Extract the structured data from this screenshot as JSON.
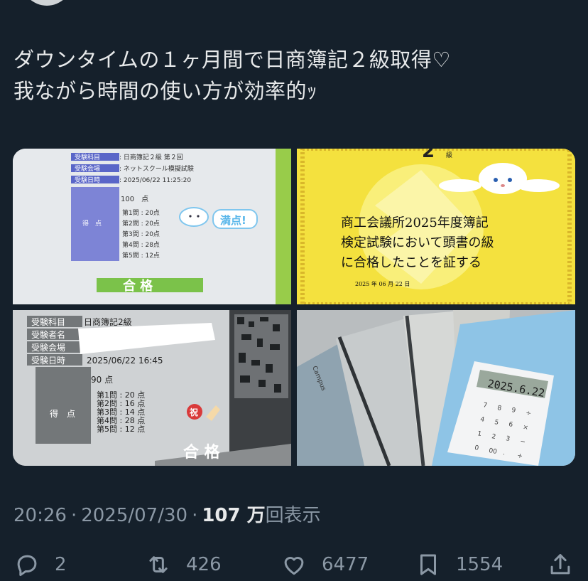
{
  "tweet": {
    "text_line1": "ダウンタイムの１ヶ月間で日商簿記２級取得♡",
    "text_line2": "我ながら時間の使い方が効率的ｯ"
  },
  "photos": {
    "p1": {
      "labels": [
        "受験科目",
        "受験会場",
        "受験日時",
        "得　点"
      ],
      "values": [
        ": 日商簿記２級 第２回",
        ": ネットスクール模擬試験",
        ": 2025/06/22 11:25:20"
      ],
      "total": "100　点",
      "scores": [
        "第1問 : 20点",
        "第2問 : 20点",
        "第3問 : 20点",
        "第4問 : 28点",
        "第5問 : 12点"
      ],
      "badge": "満点!",
      "result": "合 格"
    },
    "p2": {
      "grade": "2",
      "grade_label": "級",
      "lines": [
        "商工会議所2025年度簿記",
        "検定試験において頭書の級",
        "に合格したことを証する"
      ],
      "date": "2025 年 06 月 22 日"
    },
    "p3": {
      "labels": [
        "受験科目",
        "受験者名",
        "受験会場",
        "受験日時",
        "得　点"
      ],
      "values": [
        "日商簿記2級",
        "",
        "",
        "2025/06/22 16:45"
      ],
      "total": "90 点",
      "scores": [
        "第1問 : 20 点",
        "第2問 : 16 点",
        "第3問 : 14 点",
        "第4問 : 28 点",
        "第5問 : 12 点"
      ],
      "stamp": "祝",
      "result": "合 格"
    },
    "p4": {
      "calculator_display": "2025.6.22",
      "notebook_brand": "Campus",
      "keys": [
        "7",
        "8",
        "9",
        "÷",
        "4",
        "5",
        "6",
        "×",
        "1",
        "2",
        "3",
        "−",
        "0",
        "00",
        ".",
        "+"
      ]
    }
  },
  "meta": {
    "time": "20:26",
    "date": "2025/07/30",
    "views_count": "107 万",
    "views_label": "回表示"
  },
  "actions": {
    "reply_count": "2",
    "retweet_count": "426",
    "like_count": "6477",
    "bookmark_count": "1554"
  },
  "colors": {
    "background": "#15202b",
    "text_primary": "#e7e9ea",
    "text_secondary": "#8b98a5"
  }
}
